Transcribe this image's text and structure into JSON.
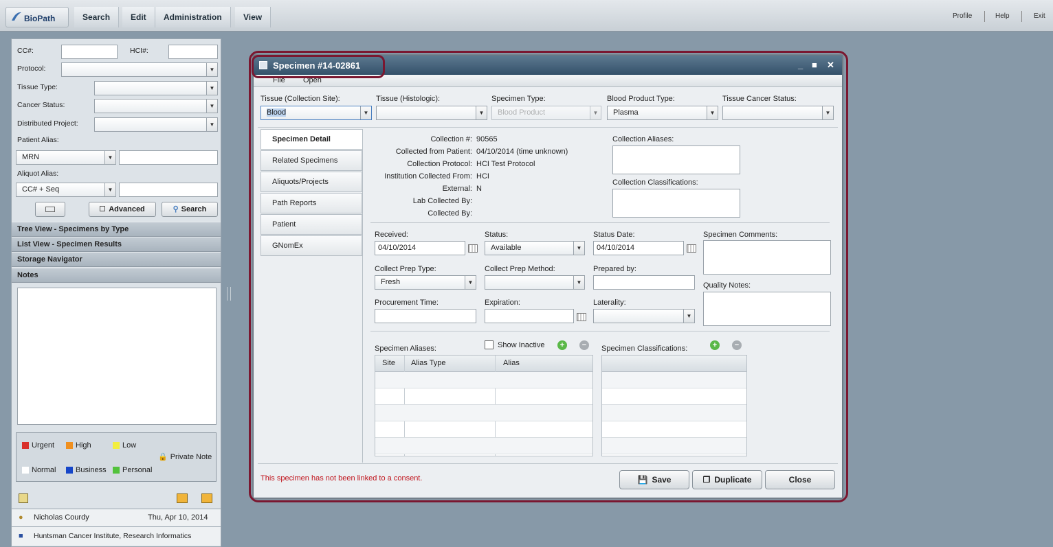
{
  "topbar": {
    "logo": "BioPath",
    "menus": [
      "Search",
      "Edit",
      "Administration",
      "View"
    ],
    "links": [
      "Profile",
      "Help",
      "Exit"
    ]
  },
  "left": {
    "cc_label": "CC#:",
    "hci_label": "HCI#:",
    "protocol_label": "Protocol:",
    "tissue_type_label": "Tissue Type:",
    "cancer_status_label": "Cancer Status:",
    "distributed_project_label": "Distributed Project:",
    "patient_alias_label": "Patient Alias:",
    "patient_alias_type": "MRN",
    "aliquot_alias_label": "Aliquot Alias:",
    "aliquot_alias_type": "CC# + Seq",
    "advanced_label": "Advanced",
    "search_label": "Search",
    "accordions": [
      "Tree View - Specimens by Type",
      "List View - Specimen Results",
      "Storage Navigator",
      "Notes"
    ],
    "legend": {
      "urgent": "Urgent",
      "high": "High",
      "low": "Low",
      "private": "Private Note",
      "normal": "Normal",
      "business": "Business",
      "personal": "Personal"
    },
    "user": "Nicholas Courdy",
    "date": "Thu, Apr 10, 2014",
    "org": "Huntsman Cancer Institute, Research Informatics"
  },
  "dialog": {
    "title": "Specimen #14-02861",
    "menu_file": "File",
    "menu_open": "Open",
    "tissue_collection_label": "Tissue (Collection Site):",
    "tissue_collection_value": "Blood",
    "tissue_histologic_label": "Tissue (Histologic):",
    "specimen_type_label": "Specimen Type:",
    "specimen_type_value": "Blood Product",
    "blood_product_type_label": "Blood Product Type:",
    "blood_product_type_value": "Plasma",
    "tissue_cancer_status_label": "Tissue Cancer Status:",
    "tabs": [
      "Specimen Detail",
      "Related Specimens",
      "Aliquots/Projects",
      "Path Reports",
      "Patient",
      "GNomEx"
    ],
    "details": {
      "collection_label": "Collection #:",
      "collection_value": "90565",
      "collected_from_label": "Collected from Patient:",
      "collected_from_value": "04/10/2014 (time unknown)",
      "protocol_label": "Collection Protocol:",
      "protocol_value": "HCI Test Protocol",
      "institution_label": "Institution Collected From:",
      "institution_value": "HCI",
      "external_label": "External:",
      "external_value": "N",
      "lab_collected_label": "Lab Collected By:",
      "collected_by_label": "Collected By:"
    },
    "collection_aliases_label": "Collection Aliases:",
    "collection_classifications_label": "Collection Classifications:",
    "received_label": "Received:",
    "received_value": "04/10/2014",
    "status_label": "Status:",
    "status_value": "Available",
    "status_date_label": "Status Date:",
    "status_date_value": "04/10/2014",
    "specimen_comments_label": "Specimen Comments:",
    "collect_prep_type_label": "Collect Prep Type:",
    "collect_prep_type_value": "Fresh",
    "collect_prep_method_label": "Collect Prep Method:",
    "prepared_by_label": "Prepared by:",
    "quality_notes_label": "Quality Notes:",
    "procurement_time_label": "Procurement Time:",
    "expiration_label": "Expiration:",
    "laterality_label": "Laterality:",
    "specimen_aliases_label": "Specimen Aliases:",
    "show_inactive_label": "Show Inactive",
    "specimen_classifications_label": "Specimen Classifications:",
    "alias_columns": [
      "Site",
      "Alias Type",
      "Alias"
    ],
    "consent_warning": "This specimen has not been linked to a consent.",
    "save_label": "Save",
    "duplicate_label": "Duplicate",
    "close_label": "Close"
  },
  "colors": {
    "highlight": "#7a1730",
    "warning": "#c0141c",
    "title_bar": "#3f5b74"
  }
}
